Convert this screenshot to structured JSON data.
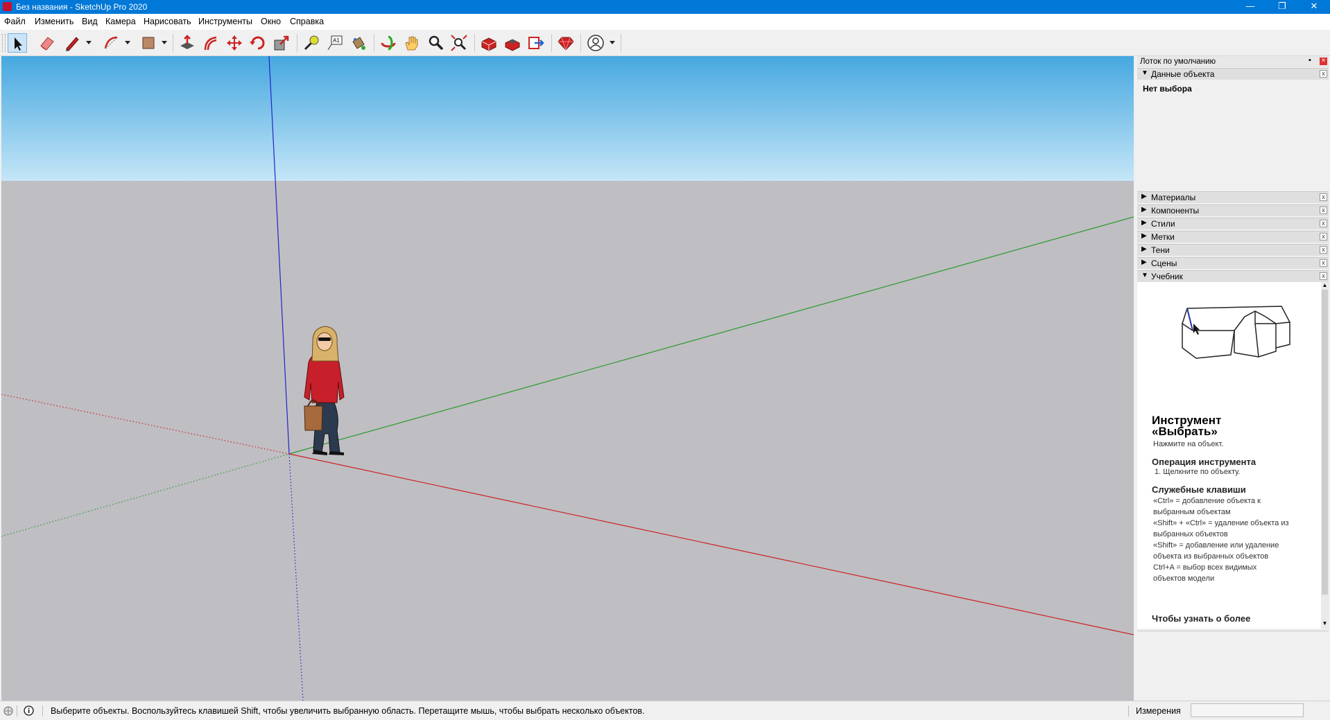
{
  "window": {
    "title": "Без названия - SketchUp Pro 2020",
    "minimize_glyph": "—",
    "maximize_glyph": "❐",
    "close_glyph": "✕"
  },
  "menu": {
    "items": [
      "Файл",
      "Изменить",
      "Вид",
      "Камера",
      "Нарисовать",
      "Инструменты",
      "Окно",
      "Справка"
    ]
  },
  "toolbar": {
    "tools": [
      "select-tool",
      "eraser-tool",
      "pencil-tool",
      "arc-tool",
      "rectangle-tool",
      "push-pull-tool",
      "offset-tool",
      "move-tool",
      "rotate-tool",
      "scale-tool",
      "tape-measure-tool",
      "text-tool",
      "paint-bucket-tool",
      "orbit-tool",
      "pan-tool",
      "zoom-tool",
      "zoom-extents-tool",
      "3d-warehouse-icon",
      "extension-warehouse-icon",
      "send-to-layout-icon",
      "ruby-console-icon",
      "account-icon"
    ],
    "active_tool": "select-tool"
  },
  "tray": {
    "title": "Лоток по умолчанию",
    "pin_glyph": "▪",
    "close_glyph": "×",
    "entity_info": {
      "header": "Данные объекта",
      "expanded": true,
      "value": "Нет выбора"
    },
    "panels": [
      {
        "label": "Материалы",
        "expanded": false
      },
      {
        "label": "Компоненты",
        "expanded": false
      },
      {
        "label": "Стили",
        "expanded": false
      },
      {
        "label": "Метки",
        "expanded": false
      },
      {
        "label": "Тени",
        "expanded": false
      },
      {
        "label": "Сцены",
        "expanded": false
      },
      {
        "label": "Учебник",
        "expanded": true
      }
    ],
    "instructor": {
      "heading": "Инструмент «Выбрать»",
      "subtitle": "Нажмите на объект.",
      "section1_title": "Операция инструмента",
      "section1_line": "1. Щелкните по объекту.",
      "section2_title": "Служебные клавиши",
      "keys": [
        "«Ctrl» = добавление объекта к выбранным объектам",
        "«Shift» + «Ctrl» = удаление объекта из выбранных объектов",
        "«Shift» = добавление или удаление объекта из выбранных объектов",
        "Ctrl+A = выбор всех видимых объектов модели"
      ],
      "more": "Чтобы узнать о более"
    }
  },
  "status": {
    "message": "Выберите объекты. Воспользуйтесь клавишей Shift, чтобы увеличить выбранную область. Перетащите мышь, чтобы выбрать несколько объектов.",
    "measurements_label": "Измерения",
    "measurements_value": ""
  },
  "colors": {
    "titlebar": "#0078d7",
    "sky_top": "#46a8e0",
    "sky_bottom": "#c5e6f7",
    "ground": "#bfbec3",
    "axis_red": "#cc2222",
    "axis_green": "#2a9a2a",
    "axis_blue": "#2222cc"
  }
}
